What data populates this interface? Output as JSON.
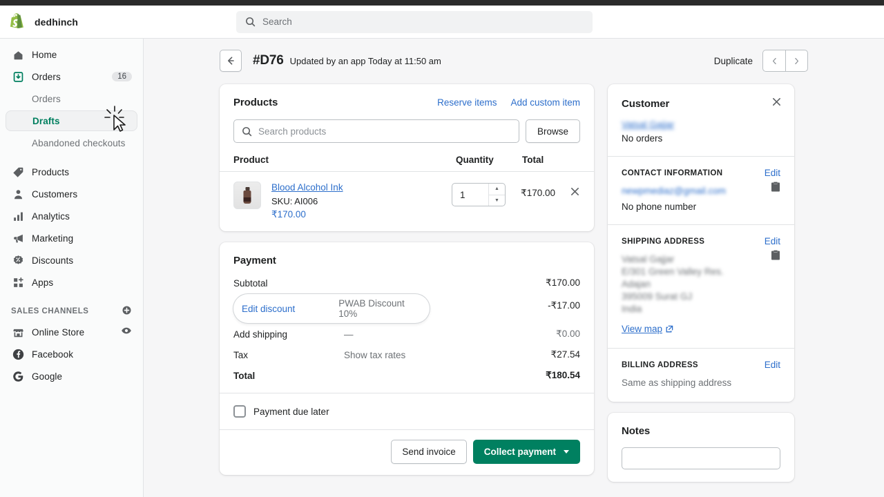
{
  "topbar": {
    "brand_name": "dedhinch",
    "logo_icon": "shopify-bag-logo",
    "search_placeholder": "Search",
    "search_value": "",
    "search_icon": "search-icon"
  },
  "sidebar": {
    "items": [
      {
        "label": "Home",
        "icon": "home-icon",
        "badge": ""
      },
      {
        "label": "Orders",
        "icon": "orders-inbox-icon",
        "badge": "16"
      }
    ],
    "sub_items": [
      {
        "label": "Orders",
        "active": false
      },
      {
        "label": "Drafts",
        "active": true
      },
      {
        "label": "Abandoned checkouts",
        "active": false
      }
    ],
    "items2": [
      {
        "label": "Products",
        "icon": "tag-icon"
      },
      {
        "label": "Customers",
        "icon": "person-icon"
      },
      {
        "label": "Analytics",
        "icon": "bar-chart-icon"
      },
      {
        "label": "Marketing",
        "icon": "megaphone-icon"
      },
      {
        "label": "Discounts",
        "icon": "discount-badge-icon"
      },
      {
        "label": "Apps",
        "icon": "apps-grid-icon"
      }
    ],
    "section_label": "SALES CHANNELS",
    "section_add_icon": "plus-circle-icon",
    "channels": [
      {
        "label": "Online Store",
        "icon": "storefront-icon",
        "trailing_icon": "eye-icon"
      },
      {
        "label": "Facebook",
        "icon": "facebook-icon",
        "trailing_icon": ""
      },
      {
        "label": "Google",
        "icon": "google-icon",
        "trailing_icon": ""
      }
    ]
  },
  "page_header": {
    "back_icon": "arrow-left-icon",
    "title": "#D76",
    "subtitle": "Updated by an app Today at 11:50 am",
    "duplicate_label": "Duplicate",
    "prev_icon": "chevron-left-icon",
    "next_icon": "chevron-right-icon"
  },
  "products_card": {
    "title": "Products",
    "reserve_items_label": "Reserve items",
    "add_custom_item_label": "Add custom item",
    "search_placeholder": "Search products",
    "search_value": "",
    "search_icon": "search-icon",
    "browse_label": "Browse",
    "columns": {
      "product": "Product",
      "quantity": "Quantity",
      "total": "Total"
    },
    "line_items": [
      {
        "name": "Blood Alcohol Ink",
        "sku": "SKU: AI006",
        "unit_price": "₹170.00",
        "quantity": "1",
        "total": "₹170.00",
        "thumbnail_icon": "ink-bottle-thumbnail",
        "remove_icon": "close-x-icon",
        "stepper_up_icon": "caret-up-icon",
        "stepper_down_icon": "caret-down-icon"
      }
    ]
  },
  "payment_card": {
    "title": "Payment",
    "rows": [
      {
        "label": "Subtotal",
        "mid": "",
        "amount": "₹170.00",
        "bold": false
      },
      {
        "label": "Add shipping",
        "mid": "—",
        "amount": "₹0.00",
        "bold": false
      },
      {
        "label": "Tax",
        "mid": "Show tax rates",
        "amount": "₹27.54",
        "bold": false
      },
      {
        "label": "Total",
        "mid": "",
        "amount": "₹180.54",
        "bold": true
      }
    ],
    "discount": {
      "edit_label": "Edit discount",
      "tag": "PWAB Discount 10%",
      "amount": "-₹17.00"
    },
    "due_later_label": "Payment due later",
    "due_later_checked": false,
    "send_invoice_label": "Send invoice",
    "collect_payment_label": "Collect payment",
    "collect_caret_icon": "caret-down-icon",
    "primary_color": "#008060"
  },
  "customer_card": {
    "title": "Customer",
    "close_icon": "close-x-icon",
    "name": "Vatsal Gajjar",
    "orders_text": "No orders",
    "contact": {
      "section_title": "CONTACT INFORMATION",
      "edit_label": "Edit",
      "email": "newpmediaz@gmail.com",
      "phone_text": "No phone number",
      "copy_icon": "clipboard-copy-icon"
    },
    "shipping": {
      "section_title": "SHIPPING ADDRESS",
      "edit_label": "Edit",
      "lines": [
        "Vatsal Gajjar",
        "E/301 Green Valley Res.",
        "Adajan",
        "395009 Surat GJ",
        "India"
      ],
      "view_map_label": "View map",
      "external_icon": "external-link-icon",
      "copy_icon": "clipboard-copy-icon"
    },
    "billing": {
      "section_title": "BILLING ADDRESS",
      "edit_label": "Edit",
      "text": "Same as shipping address"
    }
  },
  "notes_card": {
    "title": "Notes",
    "value": ""
  },
  "cursor": {
    "icon": "click-cursor-icon"
  }
}
